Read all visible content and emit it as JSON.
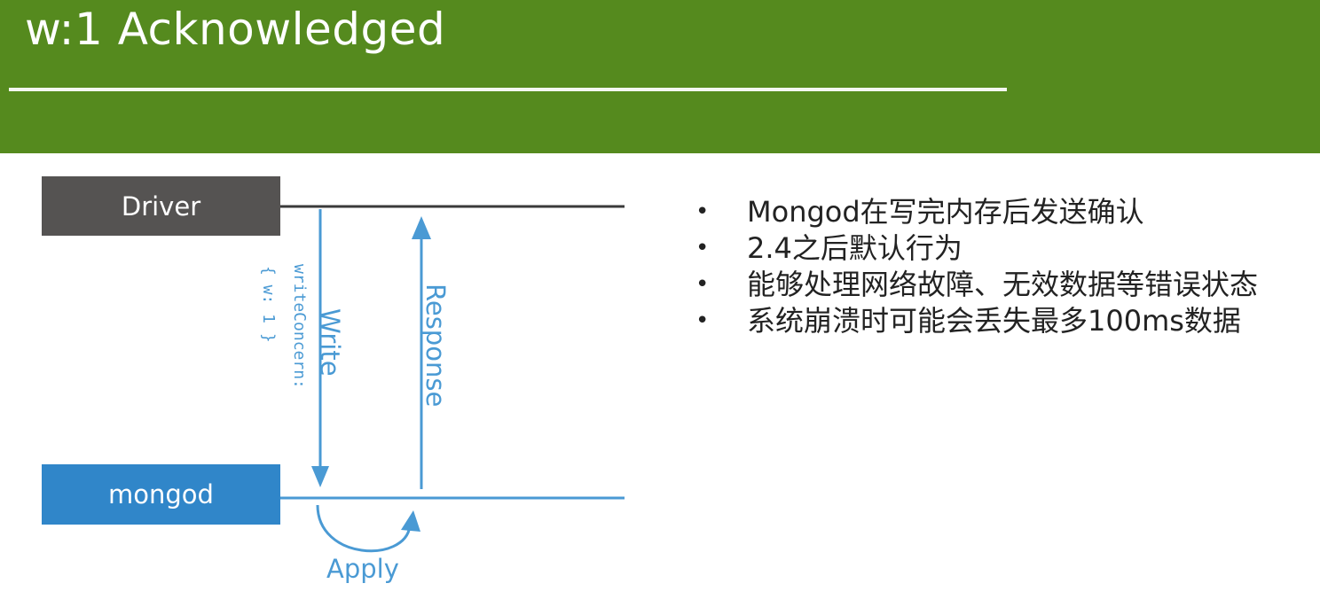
{
  "slide": {
    "title": "w:1 Acknowledged"
  },
  "diagram": {
    "driver_label": "Driver",
    "mongod_label": "mongod",
    "write_label": "Write",
    "write_concern_label": "writeConcern:",
    "write_concern_value": "{ w: 1 }",
    "response_label": "Response",
    "apply_label": "Apply"
  },
  "bullets": [
    {
      "marker": "•",
      "text": "Mongod在写完内存后发送确认"
    },
    {
      "marker": "•",
      "text": "2.4之后默认行为"
    },
    {
      "marker": "•",
      "text": "能够处理网络故障、无效数据等错误状态"
    },
    {
      "marker": "•",
      "text": "系统崩溃时可能会丢失最多100ms数据"
    }
  ],
  "colors": {
    "header_green": "#558a1e",
    "driver_gray": "#555352",
    "mongo_blue": "#3086c9",
    "arrow_blue": "#4a9ad4"
  }
}
